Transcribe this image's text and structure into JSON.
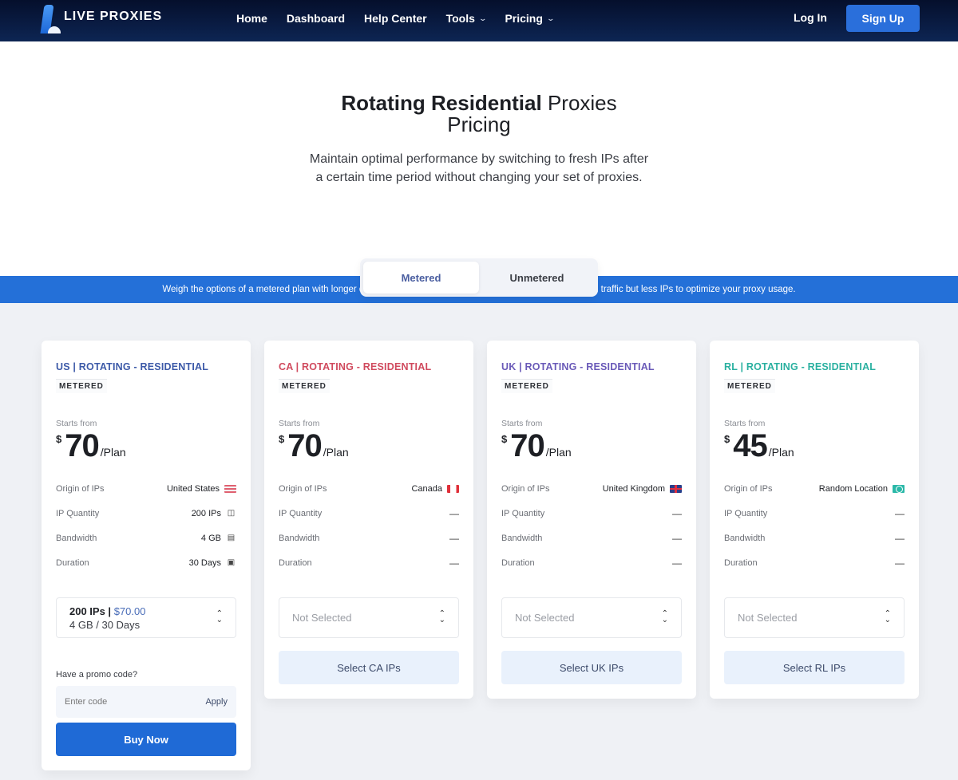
{
  "nav": {
    "brand": "LIVE PROXIES",
    "links": [
      {
        "label": "Home",
        "dropdown": false
      },
      {
        "label": "Dashboard",
        "dropdown": false
      },
      {
        "label": "Help Center",
        "dropdown": false
      },
      {
        "label": "Tools",
        "dropdown": true
      },
      {
        "label": "Pricing",
        "dropdown": true
      }
    ],
    "login": "Log In",
    "signup": "Sign Up"
  },
  "hero": {
    "title_bold": "Rotating Residential",
    "title_rest": " Proxies",
    "title_line2": "Pricing",
    "subtitle_line1": "Maintain optimal performance by switching to fresh IPs after",
    "subtitle_line2": "a certain time period without changing your set of proxies.",
    "toggle": {
      "active": "Metered",
      "inactive": "Unmetered"
    }
  },
  "banner": "Weigh the options of a metered plan with longer durations and traffic limits or unmetered plan with unlimited traffic but less IPs to optimize your proxy usage.",
  "labels": {
    "badge": "METERED",
    "starts_from": "Starts from",
    "currency": "$",
    "per": "/Plan",
    "origin": "Origin of IPs",
    "quantity": "IP Quantity",
    "bandwidth": "Bandwidth",
    "duration": "Duration",
    "dash": "—",
    "not_selected": "Not Selected",
    "promo_label": "Have a promo code?",
    "promo_placeholder": "Enter code",
    "apply": "Apply",
    "buy_now": "Buy Now"
  },
  "cards": [
    {
      "title": "US | ROTATING - RESIDENTIAL",
      "color": "#3d5aa8",
      "price": "70",
      "origin": "United States",
      "flag": "us",
      "quantity": "200 IPs",
      "bandwidth": "4 GB",
      "duration": "30 Days",
      "selected_line1": "200 IPs | ",
      "selected_price": "$70.00",
      "selected_line2": "4 GB / 30 Days"
    },
    {
      "title": "CA | ROTATING - RESIDENTIAL",
      "color": "#d04a5e",
      "price": "70",
      "origin": "Canada",
      "flag": "ca",
      "button": "Select CA IPs"
    },
    {
      "title": "UK | ROTATING - RESIDENTIAL",
      "color": "#6a5ab8",
      "price": "70",
      "origin": "United Kingdom",
      "flag": "uk",
      "button": "Select UK IPs"
    },
    {
      "title": "RL | ROTATING - RESIDENTIAL",
      "color": "#2ab0a0",
      "price": "45",
      "origin": "Random Location",
      "flag": "rl",
      "button": "Select RL IPs"
    }
  ]
}
